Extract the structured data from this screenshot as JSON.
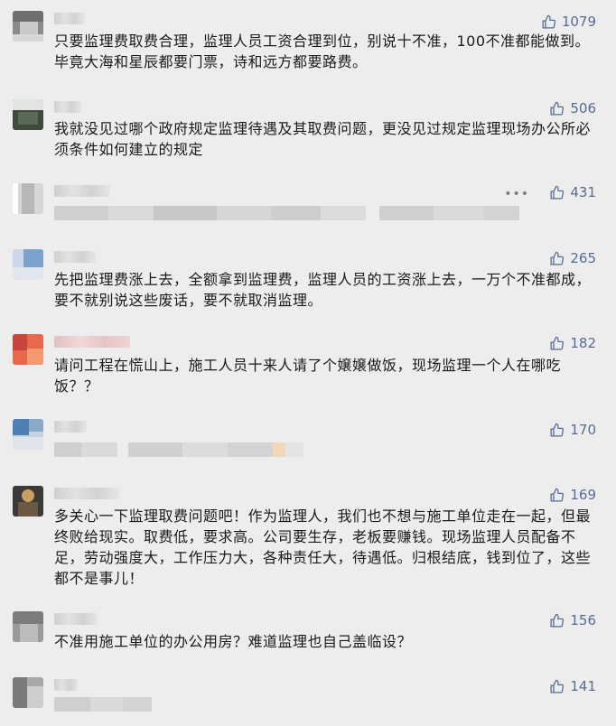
{
  "comments": [
    {
      "likes": "1079",
      "text": "只要监理费取费合理，监理人员工资合理到位，别说十不准，100不准都能做到。毕竟大海和星辰都要门票，诗和远方都要路费。"
    },
    {
      "likes": "506",
      "text": "我就没见过哪个政府规定监理待遇及其取费问题，更没见过规定监理现场办公所必须条件如何建立的规定"
    },
    {
      "likes": "431",
      "more": "•••"
    },
    {
      "likes": "265",
      "text": "先把监理费涨上去，全额拿到监理费，监理人员的工资涨上去，一万个不准都成，要不就别说这些废话，要不就取消监理。"
    },
    {
      "likes": "182",
      "text": "请问工程在慌山上，施工人员十来人请了个嬢嬢做饭，现场监理一个人在哪吃饭？？"
    },
    {
      "likes": "170"
    },
    {
      "likes": "169",
      "text": "多关心一下监理取费问题吧！作为监理人，我们也不想与施工单位走在一起，但最终败给现实。取费低，要求高。公司要生存，老板要赚钱。现场监理人员配备不足，劳动强度大，工作压力大，各种责任大，待遇低。归根结底，钱到位了，这些都不是事儿！"
    },
    {
      "likes": "156",
      "text": "不准用施工单位的办公用房？难道监理也自己盖临设？"
    },
    {
      "likes": "141"
    }
  ],
  "icons": {
    "like": "thumbs-up-icon"
  },
  "colors": {
    "accent": "#576b95",
    "background": "#ededed"
  }
}
